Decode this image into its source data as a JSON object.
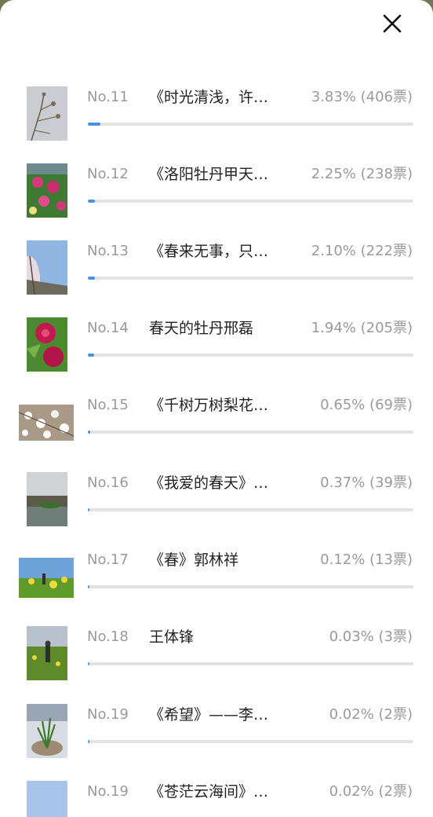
{
  "close_icon": "close-icon",
  "accent": "#4a90e2",
  "track_color": "#e2e2e2",
  "items": [
    {
      "rank": "No.11",
      "title": "《时光清浅，许…",
      "stat": "3.83% (406票)",
      "percent": 3.83
    },
    {
      "rank": "No.12",
      "title": "《洛阳牡丹甲天…",
      "stat": "2.25% (238票)",
      "percent": 2.25
    },
    {
      "rank": "No.13",
      "title": "《春来无事，只…",
      "stat": "2.10% (222票)",
      "percent": 2.1
    },
    {
      "rank": "No.14",
      "title": "春天的牡丹邢磊",
      "stat": "1.94% (205票)",
      "percent": 1.94
    },
    {
      "rank": "No.15",
      "title": "《千树万树梨花…",
      "stat": "0.65% (69票)",
      "percent": 0.65
    },
    {
      "rank": "No.16",
      "title": "《我爱的春天》…",
      "stat": "0.37% (39票)",
      "percent": 0.37
    },
    {
      "rank": "No.17",
      "title": "《春》郭林祥",
      "stat": "0.12% (13票)",
      "percent": 0.12
    },
    {
      "rank": "No.18",
      "title": "王体锋",
      "stat": "0.03% (3票)",
      "percent": 0.03
    },
    {
      "rank": "No.19",
      "title": "《希望》——李…",
      "stat": "0.02% (2票)",
      "percent": 0.02
    },
    {
      "rank": "No.19",
      "title": "《苍茫云海间》…",
      "stat": "0.02% (2票)",
      "percent": 0.02
    }
  ]
}
